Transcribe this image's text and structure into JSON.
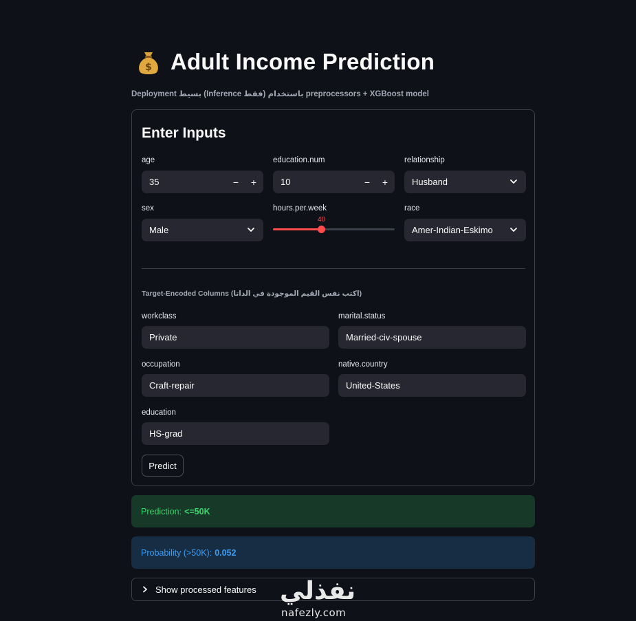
{
  "header": {
    "title": "Adult Income Prediction",
    "title_icon": "money-bag-icon",
    "subtitle": "Deployment بسيط (Inference فقط) باستخدام preprocessors + XGBoost model"
  },
  "form": {
    "title": "Enter Inputs",
    "age": {
      "label": "age",
      "value": "35",
      "minus": "−",
      "plus": "+"
    },
    "education_num": {
      "label": "education.num",
      "value": "10",
      "minus": "−",
      "plus": "+"
    },
    "relationship": {
      "label": "relationship",
      "value": "Husband"
    },
    "sex": {
      "label": "sex",
      "value": "Male"
    },
    "hours_per_week": {
      "label": "hours.per.week",
      "value": "40",
      "fraction": 0.4
    },
    "race": {
      "label": "race",
      "value": "Amer-Indian-Eskimo"
    },
    "target_encoded_caption": "Target-Encoded Columns (اكتب نفس القيم الموجودة في الداتا)",
    "workclass": {
      "label": "workclass",
      "value": "Private"
    },
    "marital_status": {
      "label": "marital.status",
      "value": "Married-civ-spouse"
    },
    "occupation": {
      "label": "occupation",
      "value": "Craft-repair"
    },
    "native_country": {
      "label": "native.country",
      "value": "United-States"
    },
    "education": {
      "label": "education",
      "value": "HS-grad"
    },
    "predict_label": "Predict"
  },
  "results": {
    "prediction_label": "Prediction:",
    "prediction_value": "<=50K",
    "probability_label": "Probability (>50K):",
    "probability_value": "0.052"
  },
  "expander": {
    "label": "Show processed features"
  },
  "watermark": {
    "arabic": "نفذلي",
    "latin": "nafezly.com"
  },
  "colors": {
    "background": "#0e1117",
    "field": "#262730",
    "accent": "#ff4b4b",
    "success_bg": "#173928",
    "success_text": "#3dd56d",
    "info_bg": "#172d43",
    "info_text": "#3d9df3"
  }
}
